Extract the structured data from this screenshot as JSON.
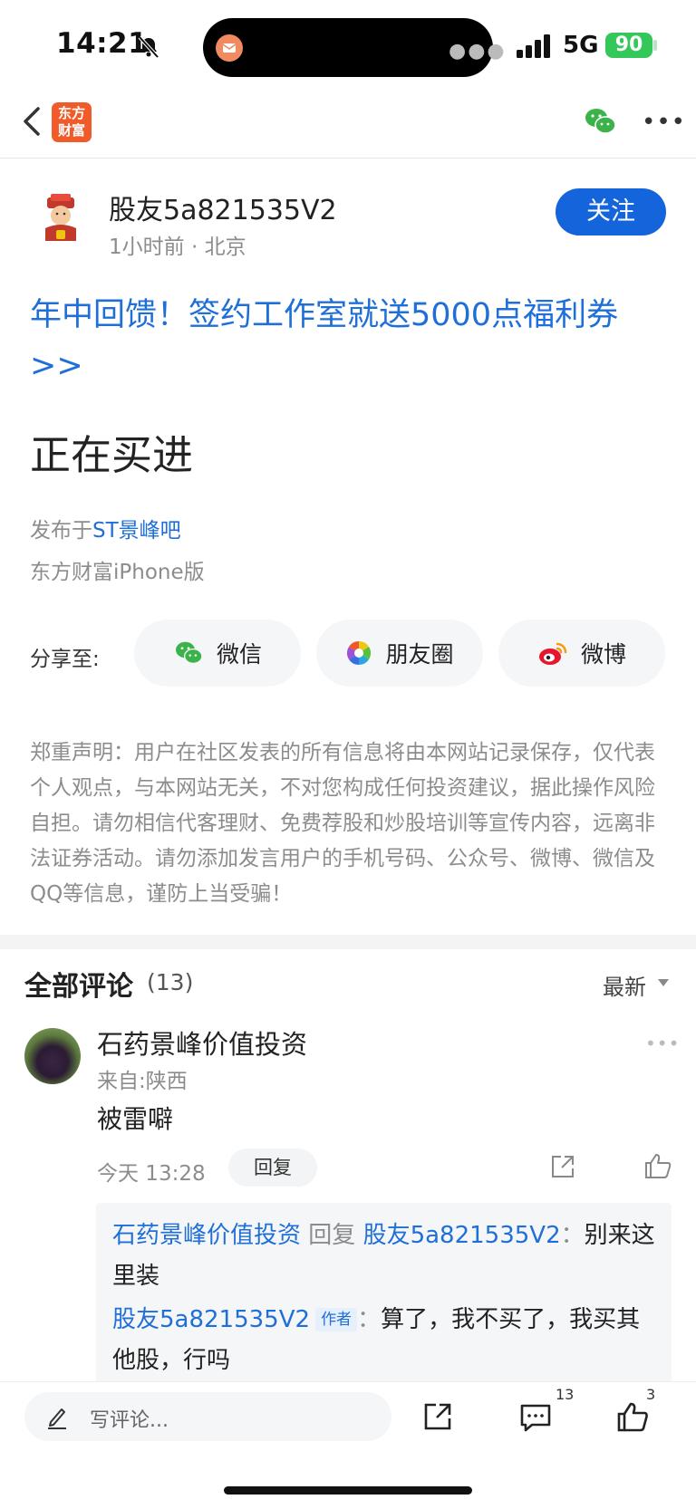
{
  "status_bar": {
    "time": "14:21",
    "network": "5G",
    "battery": "90"
  },
  "header": {
    "logo_text": "东方财富"
  },
  "author": {
    "name": "股友5a821535V2",
    "meta": "1小时前 · 北京",
    "follow_label": "关注"
  },
  "promo": {
    "text": "年中回馈！签约工作室就送5000点福利券 >>"
  },
  "post": {
    "title": "正在买进",
    "posted_in_prefix": "发布于",
    "bar_name": "ST景峰吧",
    "client": "东方财富iPhone版"
  },
  "share": {
    "label": "分享至:",
    "options": [
      {
        "label": "微信",
        "icon": "wechat-icon"
      },
      {
        "label": "朋友圈",
        "icon": "moments-icon"
      },
      {
        "label": "微博",
        "icon": "weibo-icon"
      }
    ]
  },
  "disclaimer": "郑重声明：用户在社区发表的所有信息将由本网站记录保存，仅代表个人观点，与本网站无关，不对您构成任何投资建议，据此操作风险自担。请勿相信代客理财、免费荐股和炒股培训等宣传内容，远离非法证券活动。请勿添加发言用户的手机号码、公众号、微博、微信及QQ等信息，谨防上当受骗！",
  "comments": {
    "title": "全部评论",
    "count": "(13)",
    "sort_label": "最新",
    "items": [
      {
        "name": "石药景峰价值投资",
        "from": "来自:陕西",
        "text": "被雷噼",
        "time": "今天 13:28",
        "reply_label": "回复",
        "replies": [
          {
            "from": "石药景峰价值投资",
            "verb": "回复",
            "to": "股友5a821535V2",
            "sep": "：",
            "text": "别来这里装"
          },
          {
            "from": "股友5a821535V2",
            "author_tag": "作者",
            "sep": "：",
            "text": "算了，我不买了，我买其他股，行吗"
          }
        ]
      }
    ]
  },
  "bottom_bar": {
    "comment_placeholder": "写评论...",
    "comment_count": "13",
    "like_count": "3"
  },
  "colors": {
    "accent_blue": "#1465dc",
    "link_blue": "#1f6fd8",
    "brand_orange": "#f15b2a",
    "battery_green": "#34c759"
  }
}
